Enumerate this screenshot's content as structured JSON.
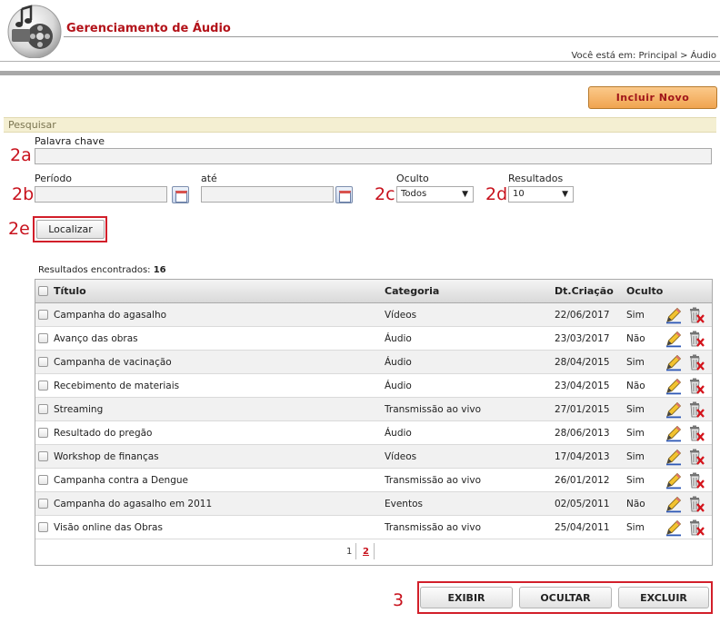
{
  "header": {
    "title": "Gerenciamento de Áudio",
    "breadcrumb_prefix": "Você está em:",
    "breadcrumb": [
      "Principal",
      "Áudio"
    ],
    "breadcrumb_sep": ">"
  },
  "toolbar": {
    "new_label": "Incluir Novo"
  },
  "search": {
    "section_label": "Pesquisar",
    "keyword_label": "Palavra chave",
    "period_label": "Período",
    "until_label": "até",
    "hidden_label": "Oculto",
    "hidden_value": "Todos",
    "results_label": "Resultados",
    "results_value": "10",
    "search_button": "Localizar"
  },
  "callouts": {
    "a": "2a",
    "b": "2b",
    "c": "2c",
    "d": "2d",
    "e": "2e",
    "three": "3"
  },
  "results": {
    "label": "Resultados encontrados:",
    "count": "16"
  },
  "table": {
    "columns": {
      "title": "Título",
      "category": "Categoria",
      "date": "Dt.Criação",
      "hidden": "Oculto"
    },
    "rows": [
      {
        "title": "Campanha do agasalho",
        "category": "Vídeos",
        "date": "22/06/2017",
        "hidden": "Sim"
      },
      {
        "title": "Avanço das obras",
        "category": "Áudio",
        "date": "23/03/2017",
        "hidden": "Não"
      },
      {
        "title": "Campanha de vacinação",
        "category": "Áudio",
        "date": "28/04/2015",
        "hidden": "Sim"
      },
      {
        "title": "Recebimento de materiais",
        "category": "Áudio",
        "date": "23/04/2015",
        "hidden": "Não"
      },
      {
        "title": "Streaming",
        "category": "Transmissão ao vivo",
        "date": "27/01/2015",
        "hidden": "Sim"
      },
      {
        "title": "Resultado do pregão",
        "category": "Áudio",
        "date": "28/06/2013",
        "hidden": "Sim"
      },
      {
        "title": "Workshop de finanças",
        "category": "Vídeos",
        "date": "17/04/2013",
        "hidden": "Sim"
      },
      {
        "title": "Campanha contra a Dengue",
        "category": "Transmissão ao vivo",
        "date": "26/01/2012",
        "hidden": "Sim"
      },
      {
        "title": "Campanha do agasalho em 2011",
        "category": "Eventos",
        "date": "02/05/2011",
        "hidden": "Não"
      },
      {
        "title": "Visão online das Obras",
        "category": "Transmissão ao vivo",
        "date": "25/04/2011",
        "hidden": "Sim"
      }
    ]
  },
  "pagination": {
    "page1": "1",
    "page2": "2",
    "current": "2"
  },
  "actions": {
    "show": "EXIBIR",
    "hide": "OCULTAR",
    "delete": "EXCLUIR"
  },
  "icons": {
    "logo": "film-reel-music-icon",
    "edit": "pencil-icon",
    "delete": "trash-icon",
    "calendar": "calendar-icon"
  },
  "colors": {
    "title_red": "#b3131a",
    "callout_red": "#c8121d",
    "new_button": "#f0a450",
    "section_bg": "#f4efd2"
  }
}
